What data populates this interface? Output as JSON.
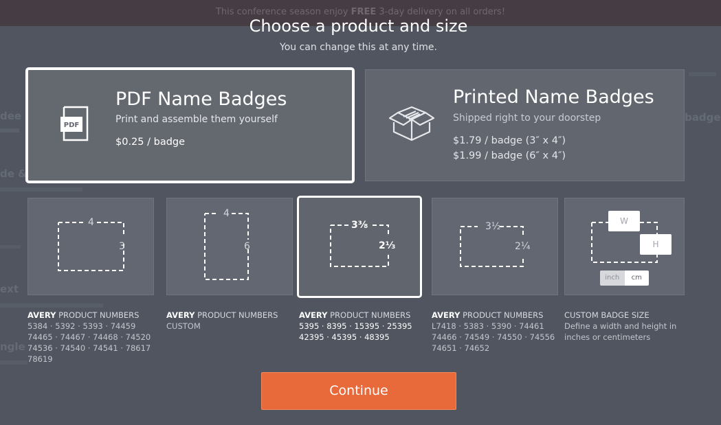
{
  "banner": {
    "pre": "This conference season enjoy",
    "bold": "FREE",
    "post": "3-day delivery on all orders!"
  },
  "background_text": [
    "dee I",
    "badge t",
    "de &",
    "ext",
    "ngle"
  ],
  "modal": {
    "title": "Choose a product and size",
    "subtitle": "You can change this at any time."
  },
  "products": [
    {
      "title": "PDF Name Badges",
      "description": "Print and assemble them yourself",
      "prices": [
        "$0.25 / badge"
      ],
      "icon": "pdf-document-icon",
      "icon_text": "PDF",
      "selected": true
    },
    {
      "title": "Printed Name Badges",
      "description": "Shipped right to your doorstep",
      "prices": [
        "$1.79 / badge (3″ x 4″)",
        "$1.99 / badge (6″ x 4″)"
      ],
      "icon": "open-box-icon",
      "selected": false
    }
  ],
  "sizes": [
    {
      "width_label": "4",
      "height_label": "3",
      "brand": "AVERY",
      "heading": "PRODUCT NUMBERS",
      "lines": [
        "5384 · 5392 · 5393 · 74459",
        "74465 · 74467 · 74468 · 74520",
        "74536 · 74540 · 74541 · 78617",
        "78619"
      ],
      "selected": false
    },
    {
      "width_label": "4",
      "height_label": "6",
      "brand": "AVERY",
      "heading": "PRODUCT NUMBERS",
      "lines": [
        "CUSTOM"
      ],
      "selected": false
    },
    {
      "width_label": "3⅜",
      "height_label": "2⅓",
      "brand": "AVERY",
      "heading": "PRODUCT NUMBERS",
      "lines": [
        "5395 · 8395 · 15395 · 25395",
        "42395 · 45395 · 48395"
      ],
      "selected": true
    },
    {
      "width_label": "3½",
      "height_label": "2¼",
      "brand": "AVERY",
      "heading": "PRODUCT NUMBERS",
      "lines": [
        "L7418 · 5383 · 5390 · 74461",
        "74466 · 74549 · 74550 · 74556",
        "74651 · 74652"
      ],
      "selected": false
    },
    {
      "width_label": "W",
      "height_label": "H",
      "brand": "",
      "heading": "CUSTOM BADGE SIZE",
      "lines": [
        "Define a width and height in",
        "inches or centimeters"
      ],
      "unit_options": [
        "inch",
        "cm"
      ],
      "selected_unit": "cm",
      "selected": false
    }
  ],
  "continue_label": "Continue",
  "colors": {
    "accent": "#e8693a",
    "overlay": "#4b505b",
    "card": "#62666f"
  }
}
